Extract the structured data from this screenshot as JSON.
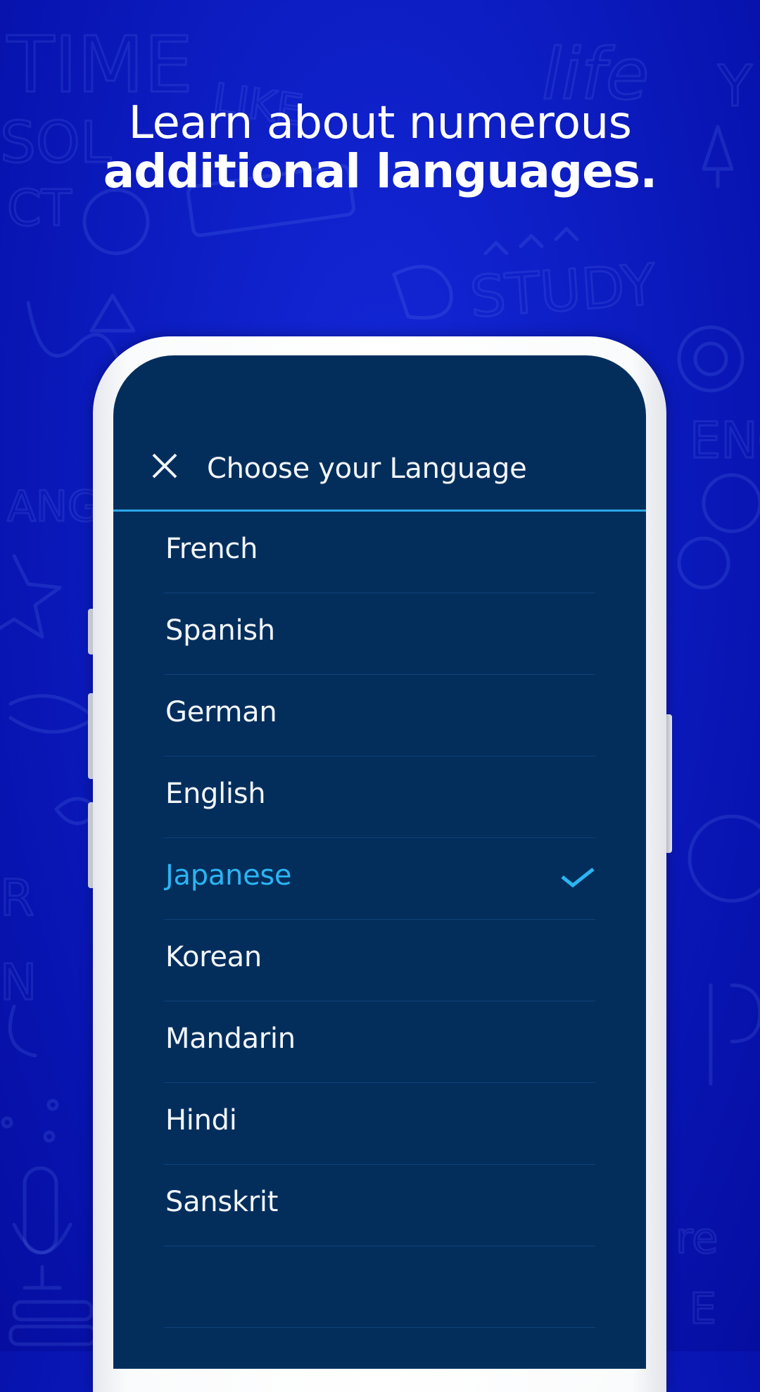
{
  "headline": {
    "line1": "Learn about numerous",
    "line2": "additional languages."
  },
  "background_doodles": [
    "TIME",
    "LIKE",
    "life",
    "Y",
    "STUDY",
    "ENG",
    "SOL",
    "CT",
    "ANG"
  ],
  "colors": {
    "background": "#0d1ec4",
    "screen": "#032e5c",
    "accent": "#2aa8e8",
    "selected_text": "#2cb4f2",
    "text": "#f2f6fa"
  },
  "screen": {
    "close_icon": "close-icon",
    "title": "Choose your Language",
    "languages": [
      {
        "label": "French",
        "selected": false
      },
      {
        "label": "Spanish",
        "selected": false
      },
      {
        "label": "German",
        "selected": false
      },
      {
        "label": "English",
        "selected": false
      },
      {
        "label": "Japanese",
        "selected": true
      },
      {
        "label": "Korean",
        "selected": false
      },
      {
        "label": "Mandarin",
        "selected": false
      },
      {
        "label": "Hindi",
        "selected": false
      },
      {
        "label": "Sanskrit",
        "selected": false
      },
      {
        "label": "",
        "selected": false
      }
    ],
    "selected_icon": "check-icon"
  }
}
